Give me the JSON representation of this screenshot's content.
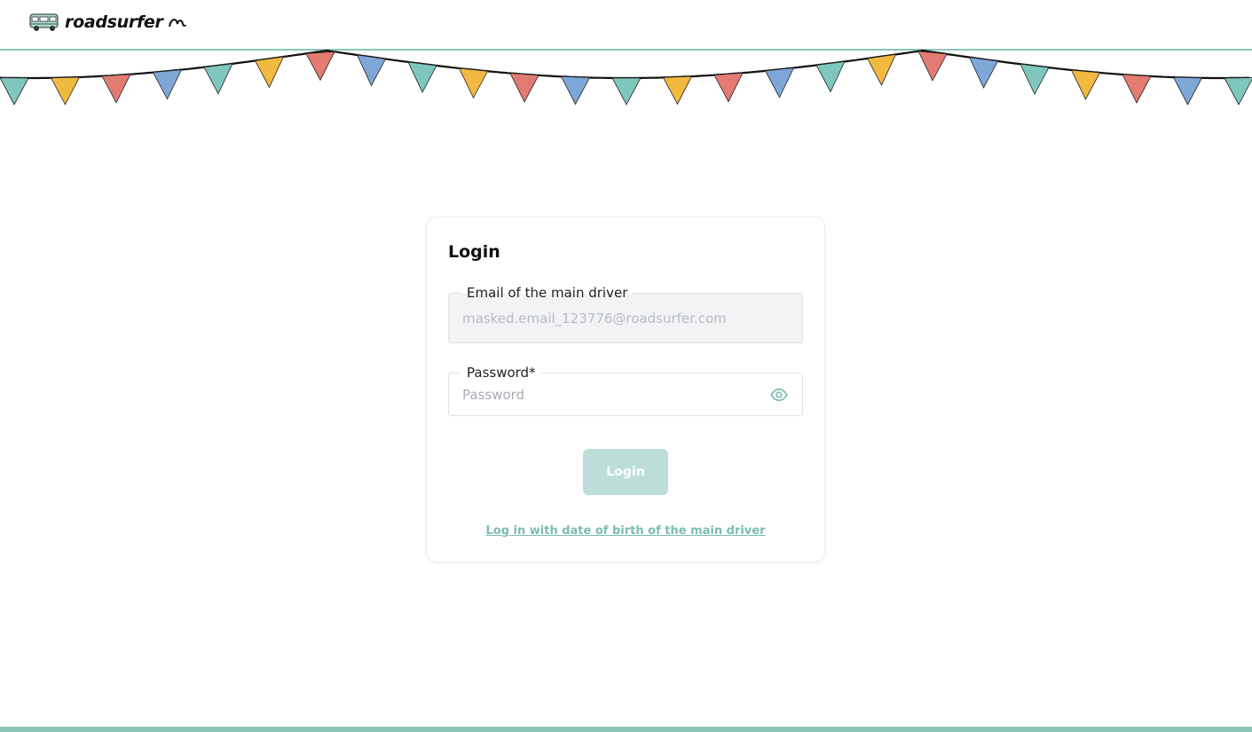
{
  "header": {
    "logo_text": "roadsurfer",
    "logo_icon": "campervan-icon"
  },
  "decoration": {
    "bunting_icon": "bunting-flags",
    "flag_colors": [
      "#7fc6bd",
      "#f2b941",
      "#e47b72",
      "#7ea7d8"
    ]
  },
  "login_card": {
    "title": "Login",
    "email_label": "Email of the main driver",
    "email_value": "masked.email_123776@roadsurfer.com",
    "password_label": "Password*",
    "password_placeholder": "Password",
    "password_toggle_icon": "eye-icon",
    "login_button_label": "Login",
    "dob_link_text": "Log in with date of birth of the main driver"
  },
  "colors": {
    "accent": "#8cc5b8",
    "button_disabled": "#bcded8",
    "link": "#7cbdb0"
  }
}
